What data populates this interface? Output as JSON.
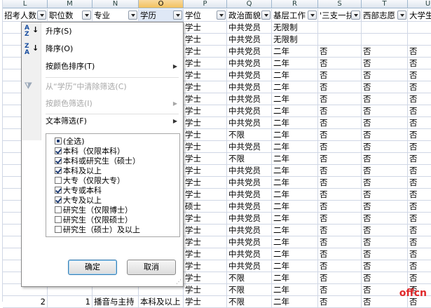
{
  "columns": [
    {
      "letter": "L",
      "header": "招考人数"
    },
    {
      "letter": "M",
      "header": "职位数"
    },
    {
      "letter": "N",
      "header": "专业"
    },
    {
      "letter": "O",
      "header": "学历"
    },
    {
      "letter": "P",
      "header": "学位"
    },
    {
      "letter": "Q",
      "header": "政治面貌"
    },
    {
      "letter": "R",
      "header": "基层工作"
    },
    {
      "letter": "S",
      "header": "'三支一扶'"
    },
    {
      "letter": "T",
      "header": "西部志愿"
    },
    {
      "letter": "U",
      "header": "大学生"
    }
  ],
  "rows": [
    {
      "P": "学士",
      "Q": "中共党员",
      "R": "无限制",
      "S": "",
      "T": "",
      "U": ""
    },
    {
      "P": "学士",
      "Q": "中共党员",
      "R": "无限制",
      "S": "",
      "T": "",
      "U": ""
    },
    {
      "P": "学士",
      "Q": "中共党员",
      "R": "二年",
      "S": "否",
      "T": "否",
      "U": "否"
    },
    {
      "P": "学士",
      "Q": "中共党员",
      "R": "二年",
      "S": "否",
      "T": "否",
      "U": "否"
    },
    {
      "P": "学士",
      "Q": "中共党员",
      "R": "二年",
      "S": "否",
      "T": "否",
      "U": "否"
    },
    {
      "P": "学士",
      "Q": "中共党员",
      "R": "二年",
      "S": "否",
      "T": "否",
      "U": "否"
    },
    {
      "P": "学士",
      "Q": "中共党员",
      "R": "二年",
      "S": "否",
      "T": "否",
      "U": "否"
    },
    {
      "P": "学士",
      "Q": "中共党员",
      "R": "二年",
      "S": "否",
      "T": "否",
      "U": "否"
    },
    {
      "P": "学士",
      "Q": "中共党员",
      "R": "二年",
      "S": "否",
      "T": "否",
      "U": "否"
    },
    {
      "P": "学士",
      "Q": "不限",
      "R": "二年",
      "S": "否",
      "T": "否",
      "U": "否"
    },
    {
      "P": "学士",
      "Q": "中共党员",
      "R": "二年",
      "S": "否",
      "T": "否",
      "U": "否"
    },
    {
      "P": "学士",
      "Q": "不限",
      "R": "二年",
      "S": "否",
      "T": "否",
      "U": "否"
    },
    {
      "P": "学士",
      "Q": "中共党员",
      "R": "二年",
      "S": "否",
      "T": "否",
      "U": "否"
    },
    {
      "P": "学士",
      "Q": "中共党员",
      "R": "二年",
      "S": "否",
      "T": "否",
      "U": "否"
    },
    {
      "P": "学士",
      "Q": "中共党员",
      "R": "二年",
      "S": "否",
      "T": "否",
      "U": "否"
    },
    {
      "P": "硕士",
      "Q": "中共党员",
      "R": "二年",
      "S": "否",
      "T": "否",
      "U": "否"
    },
    {
      "P": "学士",
      "Q": "中共党员",
      "R": "二年",
      "S": "否",
      "T": "否",
      "U": "否"
    },
    {
      "P": "学士",
      "Q": "中共党员",
      "R": "二年",
      "S": "否",
      "T": "否",
      "U": "否"
    },
    {
      "P": "学士",
      "Q": "中共党员",
      "R": "二年",
      "S": "否",
      "T": "否",
      "U": "否"
    },
    {
      "P": "学士",
      "Q": "中共党员",
      "R": "二年",
      "S": "否",
      "T": "否",
      "U": "否"
    },
    {
      "P": "学士",
      "Q": "中共党员",
      "R": "二年",
      "S": "否",
      "T": "否",
      "U": "否"
    },
    {
      "P": "学士",
      "Q": "不限",
      "R": "二年",
      "S": "否",
      "T": "否",
      "U": "否"
    },
    {
      "P": "学士",
      "Q": "不限",
      "R": "二年",
      "S": "否",
      "T": "否",
      "U": "否"
    },
    {
      "L": "2",
      "M": "1",
      "N": "播音与主持",
      "O": "本科及以上",
      "P": "学士",
      "Q": "不限",
      "R": "二年",
      "S": "否",
      "T": "否",
      "U": "否"
    }
  ],
  "menu": {
    "sort_asc": "升序(S)",
    "sort_desc": "降序(O)",
    "sort_by_color": "按颜色排序(T)",
    "clear_filter": "从“学历”中清除筛选(C)",
    "filter_by_color": "按颜色筛选(I)",
    "text_filter": "文本筛选(F)",
    "sort_asc_icon": "sort-ascending-icon",
    "sort_desc_icon": "sort-descending-icon",
    "clear_filter_icon": "clear-filter-icon"
  },
  "checklist": [
    {
      "label": "(全选)",
      "state": "mixed"
    },
    {
      "label": "本科（仅限本科）",
      "state": "checked"
    },
    {
      "label": "本科或研究生（硕士）",
      "state": "checked"
    },
    {
      "label": "本科及以上",
      "state": "checked"
    },
    {
      "label": "大专（仅限大专）",
      "state": "unchecked"
    },
    {
      "label": "大专或本科",
      "state": "checked"
    },
    {
      "label": "大专及以上",
      "state": "checked"
    },
    {
      "label": "研究生（仅限博士）",
      "state": "unchecked"
    },
    {
      "label": "研究生（仅限硕士）",
      "state": "unchecked"
    },
    {
      "label": "研究生（硕士）及以上",
      "state": "unchecked"
    }
  ],
  "buttons": {
    "ok": "确定",
    "cancel": "取消"
  },
  "watermark": "offcn",
  "colors": {
    "accent": "#3c7fb1",
    "watermark": "#e0282a",
    "active_header": "#f1c15f"
  }
}
